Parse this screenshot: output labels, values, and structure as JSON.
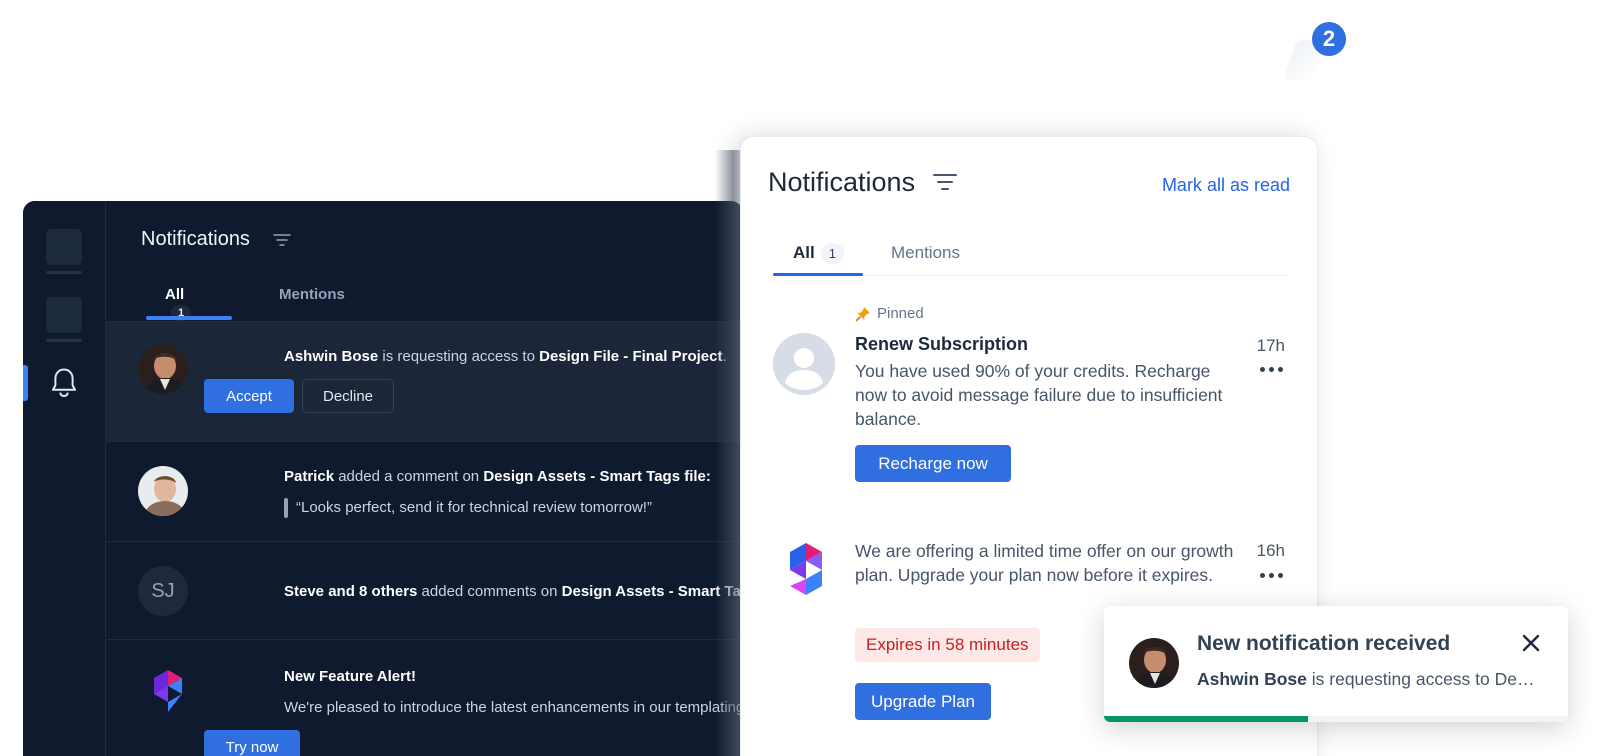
{
  "top_badge": {
    "count": "2"
  },
  "dark_panel": {
    "title": "Notifications",
    "tabs": [
      {
        "label": "All",
        "count": "1"
      },
      {
        "label": "Mentions"
      }
    ],
    "items": [
      {
        "actor": "Ashwin Bose",
        "text_mid": " is requesting access to ",
        "object": "Design File - Final Project",
        "text_end": ".",
        "accept_label": "Accept",
        "decline_label": "Decline"
      },
      {
        "actor": "Patrick",
        "text_mid": " added a comment on ",
        "object": "Design Assets - Smart Tags file:",
        "quote": "“Looks perfect, send it for technical review tomorrow!”"
      },
      {
        "avatar_initials": "SJ",
        "actor": "Steve and 8 others",
        "text_mid": " added comments on ",
        "object": "Design Assets - Smart Tags file"
      },
      {
        "heading": "New Feature Alert!",
        "body": "We're pleased to introduce the latest enhancements in our templating exp",
        "button_label": "Try now"
      }
    ]
  },
  "white_panel": {
    "title": "Notifications",
    "mark_all_label": "Mark all as read",
    "tabs": [
      {
        "label": "All",
        "count": "1"
      },
      {
        "label": "Mentions"
      }
    ],
    "pinned_label": "Pinned",
    "items": [
      {
        "heading": "Renew Subscription",
        "body": "You have used 90% of your credits. Recharge now to avoid message failure due to insufficient balance.",
        "time": "17h",
        "button_label": "Recharge now"
      },
      {
        "body": "We are offering a limited time offer on our growth plan. Upgrade your plan now before it expires.",
        "time": "16h",
        "expires_label": "Expires in 58 minutes",
        "button_label": "Upgrade Plan"
      }
    ]
  },
  "toast": {
    "title": "New notification received",
    "actor": "Ashwin Bose",
    "text": " is requesting access to Design File - Final Project.",
    "progress": 0.44
  },
  "colors": {
    "accent": "#2f6fe0",
    "dark_bg": "#0f1a2e",
    "success": "#059669",
    "danger": "#c81e1e"
  }
}
